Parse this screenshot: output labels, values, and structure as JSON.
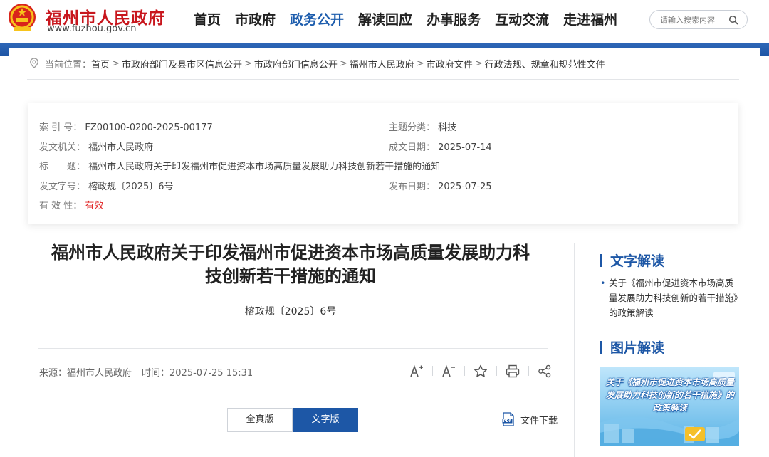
{
  "header": {
    "site_name": "福州市人民政府",
    "site_url": "www.fuzhou.gov.cn",
    "nav": [
      {
        "label": "首页",
        "active": false
      },
      {
        "label": "市政府",
        "active": false
      },
      {
        "label": "政务公开",
        "active": true
      },
      {
        "label": "解读回应",
        "active": false
      },
      {
        "label": "办事服务",
        "active": false
      },
      {
        "label": "互动交流",
        "active": false
      },
      {
        "label": "走进福州",
        "active": false
      }
    ],
    "search_placeholder": "请输入搜索内容",
    "accent_color": "#1d57a6",
    "brand_color": "#c8161d"
  },
  "breadcrumb": {
    "prefix": "当前位置：",
    "items": [
      "首页",
      "市政府部门及县市区信息公开",
      "市政府部门信息公开",
      "福州市人民政府",
      "市政府文件",
      "行政法规、规章和规范性文件"
    ],
    "separator": ">"
  },
  "info": {
    "index_label": "索 引 号：",
    "index_value": "FZ00100-0200-2025-00177",
    "topic_label": "主题分类：",
    "topic_value": "科技",
    "issuer_label": "发文机关：",
    "issuer_value": "福州市人民政府",
    "written_label": "成文日期：",
    "written_value": "2025-07-14",
    "title_label": "标　　题：",
    "title_value": "福州市人民政府关于印发福州市促进资本市场高质量发展助力科技创新若干措施的通知",
    "docno_label": "发文字号：",
    "docno_value": "榕政规〔2025〕6号",
    "publish_label": "发布日期：",
    "publish_value": "2025-07-25",
    "validity_label": "有 效 性：",
    "validity_value": "有效"
  },
  "article": {
    "title_line1": "福州市人民政府关于印发福州市促进资本市场高质量发展助力科",
    "title_line2": "技创新若干措施的通知",
    "doc_number": "榕政规〔2025〕6号",
    "source": "来源：福州市人民政府",
    "time": "时间：2025-07-25 15:31",
    "btn_full": "全真版",
    "btn_text": "文字版",
    "download": "文件下载"
  },
  "sidebar": {
    "text_interp_title": "文字解读",
    "text_interp_item": "关于《福州市促进资本市场高质量发展助力科技创新的若干措施》的政策解读",
    "image_interp_title": "图片解读",
    "image_interp_text": "关于《福州市促进资本市场高质量发展助力科技创新的若干措施》的政策解读"
  }
}
